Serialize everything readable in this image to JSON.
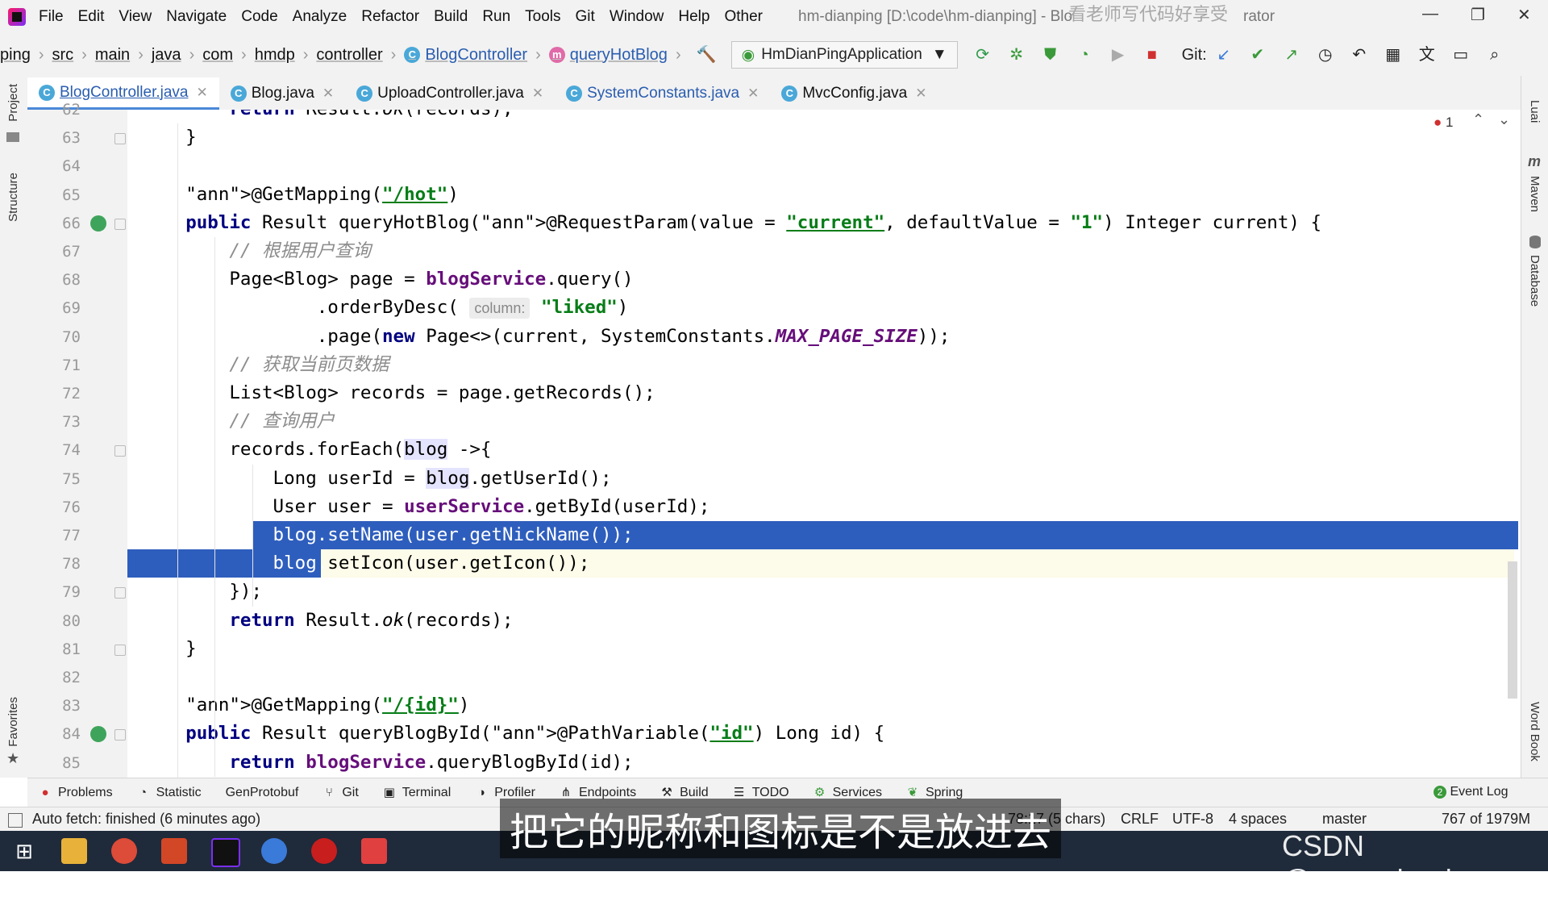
{
  "menubar": {
    "items": [
      "File",
      "Edit",
      "View",
      "Navigate",
      "Code",
      "Analyze",
      "Refactor",
      "Build",
      "Run",
      "Tools",
      "Git",
      "Window",
      "Help",
      "Other"
    ],
    "window_title": "hm-dianping [D:\\code\\hm-dianping] - Blo",
    "window_title_tail": "rator",
    "win_minimize": "—",
    "win_restore": "❐",
    "win_close": "✕"
  },
  "navbar": {
    "crumbs": [
      "ping",
      "src",
      "main",
      "java",
      "com",
      "hmdp",
      "controller"
    ],
    "class_crumb": "BlogController",
    "method_crumb": "queryHotBlog",
    "run_config": "HmDianPingApplication",
    "git_label": "Git:"
  },
  "tabs": [
    {
      "label": "BlogController.java",
      "active": true
    },
    {
      "label": "Blog.java",
      "active": false
    },
    {
      "label": "UploadController.java",
      "active": false
    },
    {
      "label": "SystemConstants.java",
      "active": false
    },
    {
      "label": "MvcConfig.java",
      "active": false
    }
  ],
  "editor": {
    "error_count": "1",
    "lines": [
      {
        "n": "62",
        "code": "        return Result.ok(records);"
      },
      {
        "n": "63",
        "code": "    }"
      },
      {
        "n": "64",
        "code": ""
      },
      {
        "n": "65",
        "code": "    @GetMapping(\"/hot\")"
      },
      {
        "n": "66",
        "code": "    public Result queryHotBlog(@RequestParam(value = \"current\", defaultValue = \"1\") Integer current) {"
      },
      {
        "n": "67",
        "code": "        // 根据用户查询"
      },
      {
        "n": "68",
        "code": "        Page<Blog> page = blogService.query()"
      },
      {
        "n": "69",
        "code": "                .orderByDesc( column: \"liked\")"
      },
      {
        "n": "70",
        "code": "                .page(new Page<>(current, SystemConstants.MAX_PAGE_SIZE));"
      },
      {
        "n": "71",
        "code": "        // 获取当前页数据"
      },
      {
        "n": "72",
        "code": "        List<Blog> records = page.getRecords();"
      },
      {
        "n": "73",
        "code": "        // 查询用户"
      },
      {
        "n": "74",
        "code": "        records.forEach(blog ->{"
      },
      {
        "n": "75",
        "code": "            Long userId = blog.getUserId();"
      },
      {
        "n": "76",
        "code": "            User user = userService.getById(userId);"
      },
      {
        "n": "77",
        "code": "            blog.setName(user.getNickName());"
      },
      {
        "n": "78",
        "code": "            blog.setIcon(user.getIcon());"
      },
      {
        "n": "79",
        "code": "        });"
      },
      {
        "n": "80",
        "code": "        return Result.ok(records);"
      },
      {
        "n": "81",
        "code": "    }"
      },
      {
        "n": "82",
        "code": ""
      },
      {
        "n": "83",
        "code": "    @GetMapping(\"/{id}\")"
      },
      {
        "n": "84",
        "code": "    public Result queryBlogById(@PathVariable(\"id\") Long id) {"
      },
      {
        "n": "85",
        "code": "        return blogService.queryBlogById(id);"
      }
    ]
  },
  "left_strip": {
    "project": "Project",
    "structure": "Structure",
    "favorites": "Favorites"
  },
  "right_strip": {
    "luai": "Luai",
    "maven": "Maven",
    "database": "Database",
    "wordbook": "Word Book"
  },
  "toolwindows": [
    "Problems",
    "Statistic",
    "GenProtobuf",
    "Git",
    "Terminal",
    "Profiler",
    "Endpoints",
    "Build",
    "TODO",
    "Services",
    "Spring"
  ],
  "event_log": {
    "count": "2",
    "label": "Event Log"
  },
  "status": {
    "message": "Auto fetch: finished (6 minutes ago)",
    "position": "78:17 (5 chars)",
    "line_sep": "CRLF",
    "encoding": "UTF-8",
    "indent": "4 spaces",
    "branch": "master",
    "memory": "767 of 1979M"
  },
  "overlay": {
    "subtitle": "把它的昵称和图标是不是放进去",
    "watermark": "CSDN @wang_book",
    "title_watermark": "看老师写代码好享受"
  },
  "colors": {
    "selection": "#2e5ebd",
    "keyword": "#000080",
    "string": "#067d17",
    "annotation": "#808000",
    "field": "#660e7a",
    "comment": "#8c8c8c"
  }
}
